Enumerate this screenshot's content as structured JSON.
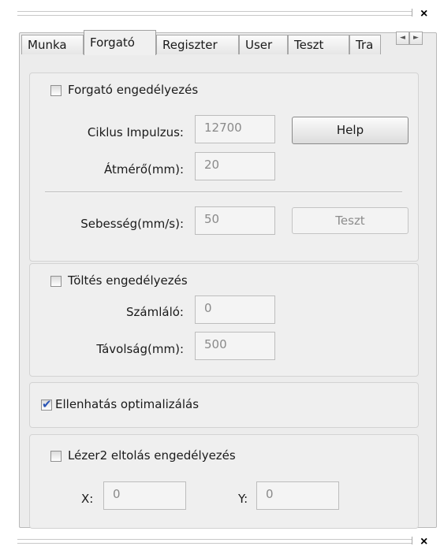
{
  "window": {
    "close_symbol": "×"
  },
  "tabs": [
    {
      "label": "Munka",
      "active": false
    },
    {
      "label": "Forgató",
      "active": true
    },
    {
      "label": "Regiszter",
      "active": false
    },
    {
      "label": "User",
      "active": false
    },
    {
      "label": "Teszt",
      "active": false
    },
    {
      "label": "Tra",
      "active": false
    }
  ],
  "tab_scroll": {
    "left": "◄",
    "right": "►"
  },
  "forgato": {
    "enable_label": "Forgató engedélyezés",
    "enable_checked": false,
    "ciklus_label": "Ciklus Impulzus:",
    "ciklus_value": "12700",
    "atmero_label": "Átmérő(mm):",
    "atmero_value": "20",
    "help_label": "Help",
    "sebesseg_label": "Sebesség(mm/s):",
    "sebesseg_value": "50",
    "teszt_label": "Teszt"
  },
  "toltes": {
    "enable_label": "Töltés engedélyezés",
    "enable_checked": false,
    "szamlalo_label": "Számláló:",
    "szamlalo_value": "0",
    "tavolsag_label": "Távolság(mm):",
    "tavolsag_value": "500"
  },
  "ellenhatas": {
    "label": "Ellenhatás optimalizálás",
    "checked": true
  },
  "lezer2": {
    "enable_label": "Lézer2 eltolás engedélyezés",
    "enable_checked": false,
    "x_label": "X:",
    "x_value": "0",
    "y_label": "Y:",
    "y_value": "0"
  },
  "colors": {
    "accent_check": "#2b55b6"
  }
}
